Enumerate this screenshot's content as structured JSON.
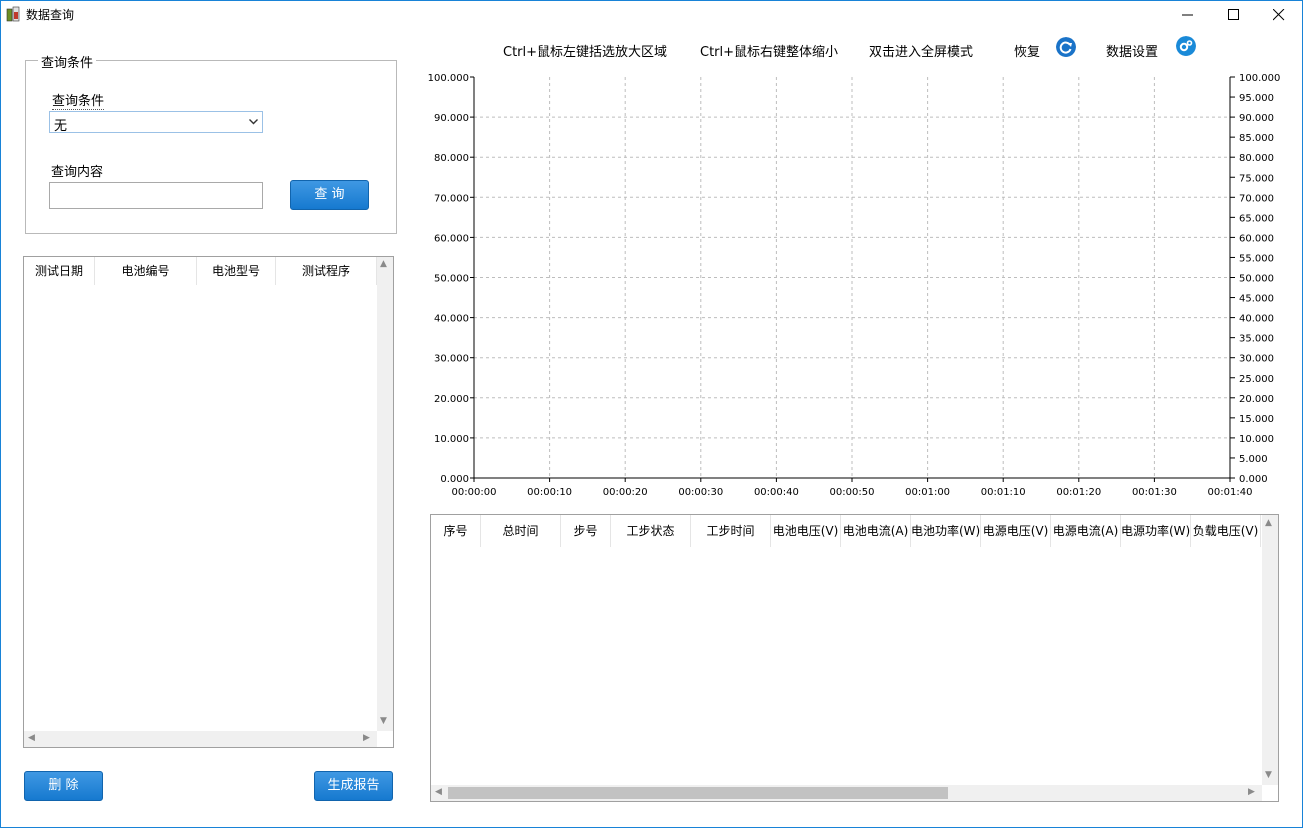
{
  "window": {
    "title": "数据查询"
  },
  "query_group": {
    "title": "查询条件",
    "condition_label": "查询条件",
    "condition_value": "无",
    "content_label": "查询内容",
    "content_value": "",
    "query_button": "查 询"
  },
  "test_list": {
    "columns": [
      "测试日期",
      "电池编号",
      "电池型号",
      "测试程序"
    ],
    "rows": []
  },
  "buttons": {
    "delete": "删 除",
    "report": "生成报告"
  },
  "toolbar": {
    "zoom_hint": "Ctrl+鼠标左键括选放大区域",
    "shrink_hint": "Ctrl+鼠标右键整体缩小",
    "fullscreen_hint": "双击进入全屏模式",
    "restore_label": "恢复",
    "restore_icon": "refresh-icon",
    "settings_label": "数据设置",
    "settings_icon": "gear-icon"
  },
  "chart_data": {
    "type": "line",
    "series": [],
    "x_ticks": [
      "00:00:00",
      "00:00:10",
      "00:00:20",
      "00:00:30",
      "00:00:40",
      "00:00:50",
      "00:01:00",
      "00:01:10",
      "00:01:20",
      "00:01:30",
      "00:01:40"
    ],
    "y_left_ticks": [
      "0.000",
      "10.000",
      "20.000",
      "30.000",
      "40.000",
      "50.000",
      "60.000",
      "70.000",
      "80.000",
      "90.000",
      "100.000"
    ],
    "y_right_ticks": [
      "0.000",
      "5.000",
      "10.000",
      "15.000",
      "20.000",
      "25.000",
      "30.000",
      "35.000",
      "40.000",
      "45.000",
      "50.000",
      "55.000",
      "60.000",
      "65.000",
      "70.000",
      "75.000",
      "80.000",
      "85.000",
      "90.000",
      "95.000",
      "100.000"
    ],
    "ylim_left": [
      0,
      100
    ],
    "ylim_right": [
      0,
      100
    ],
    "grid": true,
    "title": "",
    "xlabel": "",
    "ylabel": ""
  },
  "data_grid": {
    "columns": [
      "序号",
      "总时间",
      "步号",
      "工步状态",
      "工步时间",
      "电池电压(V)",
      "电池电流(A)",
      "电池功率(W)",
      "电源电压(V)",
      "电源电流(A)",
      "电源功率(W)",
      "负载电压(V)"
    ],
    "rows": []
  },
  "colors": {
    "accent": "#1679cf",
    "window_border": "#1883d7",
    "grid": "#bdbdbd"
  }
}
